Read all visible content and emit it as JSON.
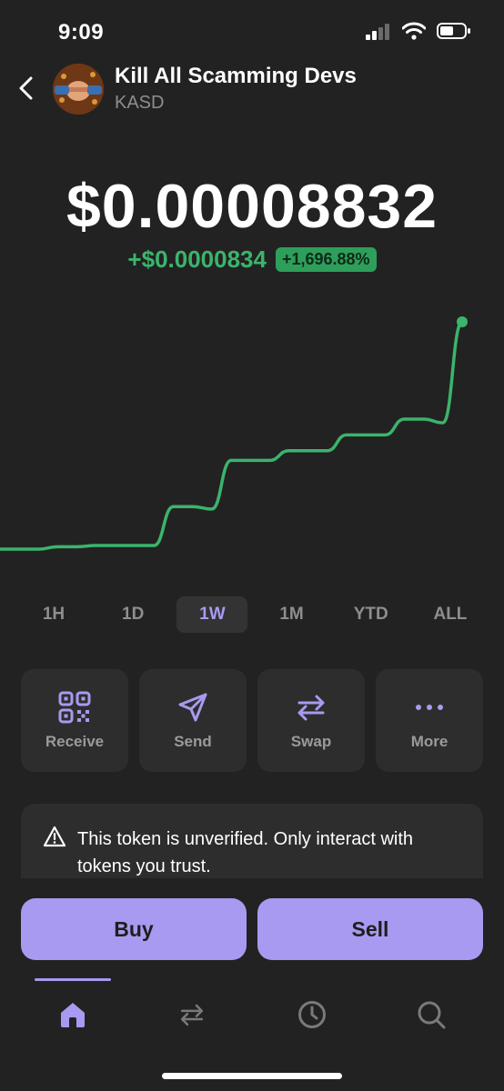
{
  "status": {
    "time": "9:09"
  },
  "token": {
    "name": "Kill All Scamming Devs",
    "symbol": "KASD"
  },
  "price": {
    "value": "$0.00008832",
    "change_abs": "+$0.0000834",
    "change_pct": "+1,696.88%"
  },
  "colors": {
    "accent": "#a89af0",
    "positive": "#3bb46c",
    "background": "#222222",
    "card": "#2d2d2d"
  },
  "chart_data": {
    "type": "line",
    "series": [
      {
        "values": [
          4.9,
          4.9,
          4.9,
          5.1,
          5.1,
          5.2,
          5.2,
          5.2,
          5.2,
          8.4,
          8.4,
          8.2,
          12.2,
          12.2,
          12.2,
          13.0,
          13.0,
          13.0,
          14.3,
          14.3,
          14.3,
          15.6,
          15.6,
          15.3,
          23.6
        ]
      }
    ],
    "grid": false,
    "legend": "none"
  },
  "ranges": {
    "items": [
      "1H",
      "1D",
      "1W",
      "1M",
      "YTD",
      "ALL"
    ],
    "selected": "1W"
  },
  "actions": {
    "receive": {
      "label": "Receive",
      "icon": "qr-code-icon"
    },
    "send": {
      "label": "Send",
      "icon": "send-icon"
    },
    "swap": {
      "label": "Swap",
      "icon": "swap-icon"
    },
    "more": {
      "label": "More",
      "icon": "more-icon"
    }
  },
  "warning": {
    "icon": "warning-icon",
    "text": "This token is unverified. Only interact with tokens you trust."
  },
  "buttons": {
    "buy": "Buy",
    "sell": "Sell"
  },
  "nav": {
    "items": [
      {
        "icon": "home-icon",
        "active": true
      },
      {
        "icon": "swap-icon",
        "active": false
      },
      {
        "icon": "history-icon",
        "active": false
      },
      {
        "icon": "search-icon",
        "active": false
      }
    ]
  }
}
